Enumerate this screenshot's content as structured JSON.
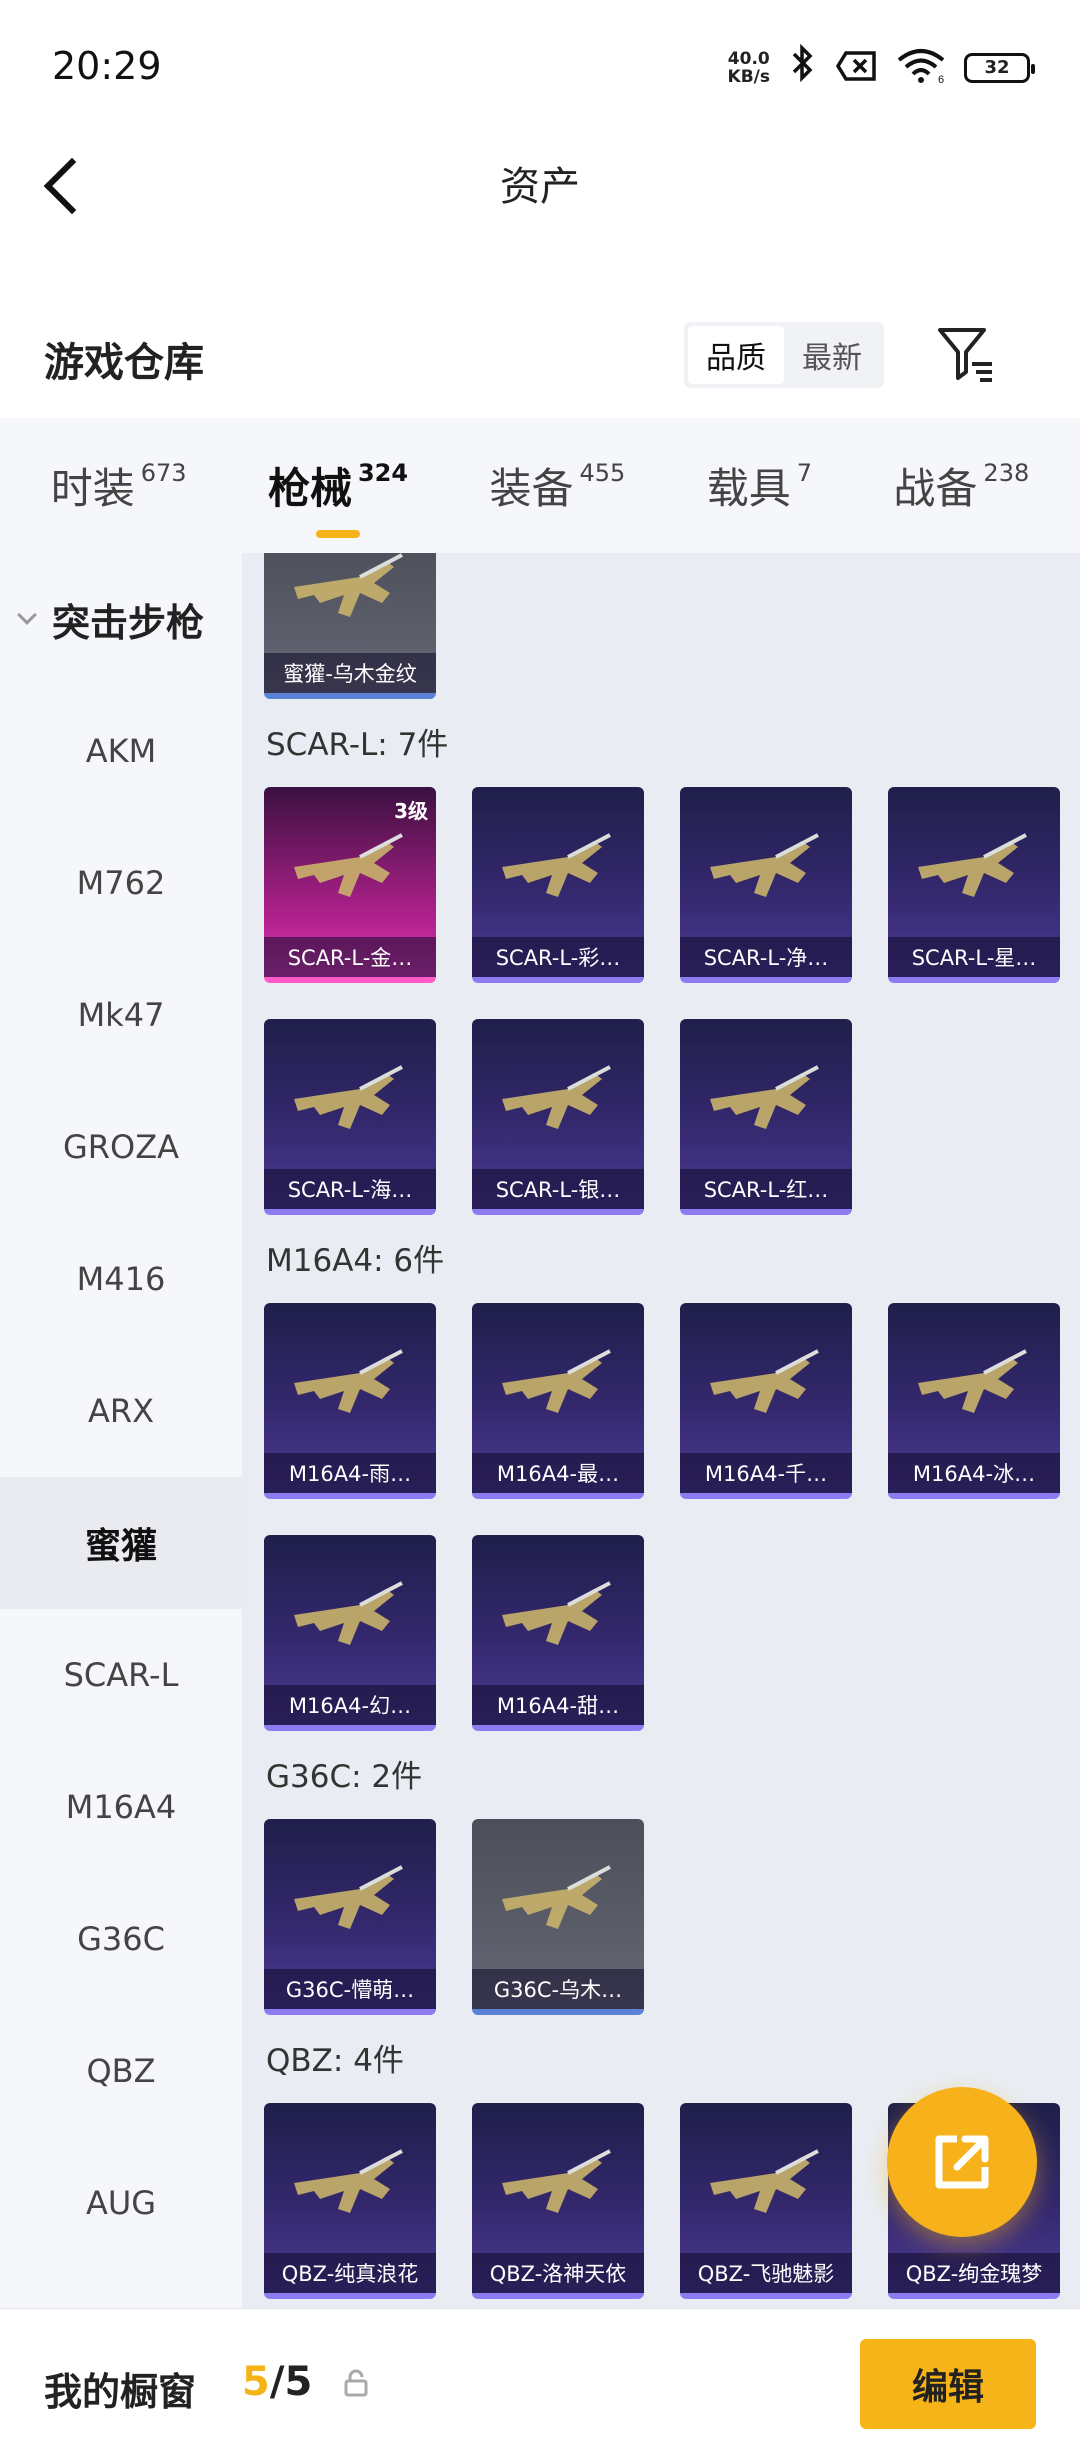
{
  "status": {
    "time": "20:29",
    "net_speed_value": "40.0",
    "net_speed_unit": "KB/s",
    "battery": "32",
    "wifi_sub": "6"
  },
  "header": {
    "title": "资产"
  },
  "warehouse": {
    "label": "游戏仓库",
    "sort_quality": "品质",
    "sort_latest": "最新"
  },
  "tabs": [
    {
      "label": "时装",
      "count": "673"
    },
    {
      "label": "枪械",
      "count": "324"
    },
    {
      "label": "装备",
      "count": "455"
    },
    {
      "label": "载具",
      "count": "7"
    },
    {
      "label": "战备",
      "count": "238"
    }
  ],
  "sidebar": {
    "group": "突击步枪",
    "items": [
      "AKM",
      "M762",
      "Mk47",
      "GROZA",
      "M416",
      "ARX",
      "蜜獾",
      "SCAR-L",
      "M16A4",
      "G36C",
      "QBZ",
      "AUG"
    ]
  },
  "sections": {
    "top_card": "蜜獾-乌木金纹",
    "scar": {
      "title": "SCAR-L: 7件",
      "level_badge": "3级",
      "cards": [
        "SCAR-L-金…",
        "SCAR-L-彩…",
        "SCAR-L-净…",
        "SCAR-L-星…",
        "SCAR-L-海…",
        "SCAR-L-银…",
        "SCAR-L-红…"
      ]
    },
    "m16": {
      "title": "M16A4: 6件",
      "cards": [
        "M16A4-雨…",
        "M16A4-最…",
        "M16A4-千…",
        "M16A4-冰…",
        "M16A4-幻…",
        "M16A4-甜…"
      ]
    },
    "g36": {
      "title": "G36C: 2件",
      "cards": [
        "G36C-懵萌…",
        "G36C-乌木…"
      ]
    },
    "qbz": {
      "title": "QBZ: 4件",
      "cards": [
        "QBZ-纯真浪花",
        "QBZ-洛神天依",
        "QBZ-飞驰魅影",
        "QBZ-绚金瑰梦"
      ]
    }
  },
  "bottom": {
    "label": "我的橱窗",
    "count_current": "5",
    "count_total": "/5",
    "edit": "编辑"
  },
  "colors": {
    "accent": "#f5b318",
    "card_purple": "#34286e",
    "card_pink": "#b3218d",
    "card_grey": "#5d606c"
  },
  "icons": [
    "back-arrow-icon",
    "bluetooth-icon",
    "sim-off-icon",
    "wifi-icon",
    "battery-icon",
    "filter-icon",
    "chevron-down-icon",
    "gun-icon",
    "share-external-icon",
    "lock-icon"
  ]
}
